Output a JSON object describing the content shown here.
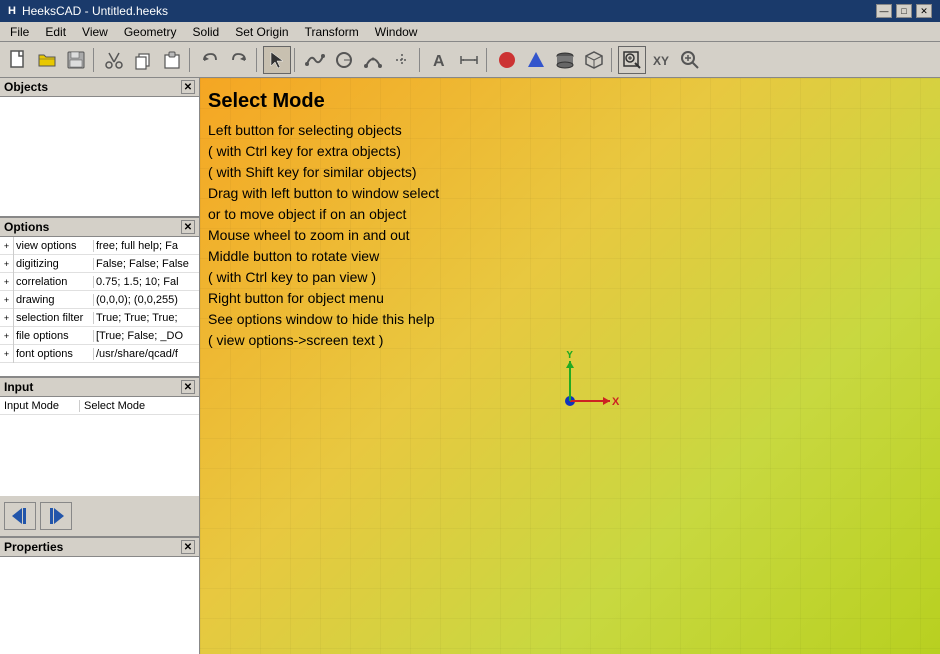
{
  "titlebar": {
    "icon": "H",
    "title": "HeeksCAD - Untitled.heeks",
    "minimize": "—",
    "maximize": "□",
    "close": "✕"
  },
  "menubar": {
    "items": [
      "File",
      "Edit",
      "View",
      "Geometry",
      "Solid",
      "Set Origin",
      "Transform",
      "Window"
    ]
  },
  "toolbar": {
    "buttons": [
      {
        "name": "new",
        "icon": "📄"
      },
      {
        "name": "open",
        "icon": "📂"
      },
      {
        "name": "save",
        "icon": "💾"
      },
      {
        "name": "cut",
        "icon": "✂"
      },
      {
        "name": "copy",
        "icon": "📋"
      },
      {
        "name": "paste",
        "icon": "📌"
      },
      {
        "name": "undo",
        "icon": "↩"
      },
      {
        "name": "redo",
        "icon": "↪"
      },
      {
        "name": "select",
        "icon": "↖"
      },
      {
        "name": "sep1",
        "sep": true
      },
      {
        "name": "curve",
        "icon": "〜"
      },
      {
        "name": "circle",
        "icon": "◎"
      },
      {
        "name": "arc",
        "icon": "⌒"
      },
      {
        "name": "sep2",
        "sep": true
      },
      {
        "name": "text",
        "icon": "A"
      },
      {
        "name": "dimension",
        "icon": "⟺"
      },
      {
        "name": "sep3",
        "sep": true
      },
      {
        "name": "sphere",
        "icon": "●"
      },
      {
        "name": "cone",
        "icon": "▲"
      },
      {
        "name": "cylinder",
        "icon": "⬭"
      },
      {
        "name": "box",
        "icon": "⬜"
      },
      {
        "name": "sep4",
        "sep": true
      },
      {
        "name": "zoom-window",
        "icon": "🔍"
      },
      {
        "name": "zoom-all",
        "icon": "⊕"
      },
      {
        "name": "zoom-in",
        "icon": "🔍"
      }
    ]
  },
  "objects_panel": {
    "title": "Objects",
    "items": []
  },
  "options_panel": {
    "title": "Options",
    "rows": [
      {
        "name": "view options",
        "value": "free; full help; Fa"
      },
      {
        "name": "digitizing",
        "value": "False; False; False"
      },
      {
        "name": "correlation",
        "value": "0.75; 1.5; 10; Fal"
      },
      {
        "name": "drawing",
        "value": "(0,0,0); (0,0,255)"
      },
      {
        "name": "selection filter",
        "value": "True; True; True;"
      },
      {
        "name": "file options",
        "value": "[True; False; _DO"
      },
      {
        "name": "font options",
        "value": "/usr/share/qcad/f"
      }
    ]
  },
  "input_panel": {
    "title": "Input",
    "rows": [
      {
        "label": "Input Mode",
        "value": "Select Mode"
      }
    ],
    "buttons": [
      {
        "name": "back",
        "icon": "◁"
      },
      {
        "name": "forward",
        "icon": "▷"
      }
    ]
  },
  "properties_panel": {
    "title": "Properties",
    "items": []
  },
  "canvas": {
    "select_mode_title": "Select Mode",
    "instructions": [
      "Left button for selecting objects",
      "( with Ctrl key for extra objects)",
      "( with Shift key for similar objects)",
      "Drag with left button to window select",
      "or to move object if on an object",
      "Mouse wheel to zoom in and out",
      "Middle button to rotate view",
      "( with Ctrl key to pan view )",
      "Right button for object menu",
      "See options window to hide this help",
      "( view options->screen text )"
    ]
  }
}
